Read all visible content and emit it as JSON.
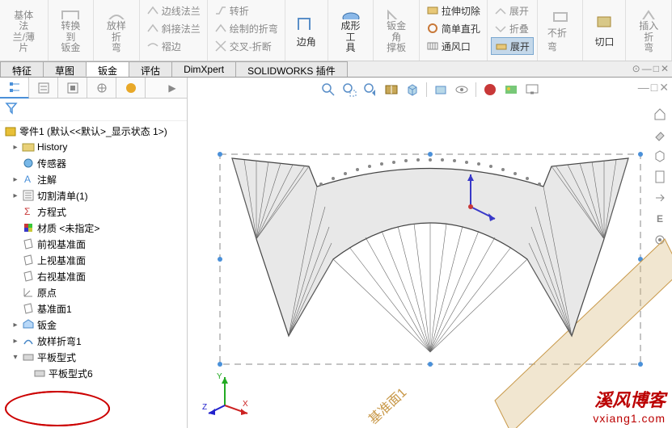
{
  "ribbon": {
    "base_flange": "基体法\n兰/薄片",
    "convert": "转换到\n钣金",
    "lofted_bend": "放样折\n弯",
    "edge_flange": "边线法兰",
    "miter_flange": "斜接法兰",
    "hem": "褶边",
    "jog": "转折",
    "sketched_bend": "绘制的折弯",
    "cross_break": "交叉-折断",
    "corner": "边角",
    "forming_tool": "成形工\n具",
    "gusset": "钣金角\n撑板",
    "extruded_cut": "拉伸切除",
    "simple_hole": "简单直孔",
    "vent": "通风口",
    "unfold": "展开",
    "fold": "折叠",
    "no_bends": "不折弯",
    "flatten": "展开",
    "cut": "切口",
    "insert_bends": "插入折\n弯"
  },
  "tabs": {
    "feature": "特征",
    "sketch": "草图",
    "sheetmetal": "钣金",
    "evaluate": "评估",
    "dimxpert": "DimXpert",
    "addins": "SOLIDWORKS 插件"
  },
  "tree": {
    "root": "零件1 (默认<<默认>_显示状态 1>)",
    "history": "History",
    "sensors": "传感器",
    "annotations": "注解",
    "cutlist": "切割清单(1)",
    "equations": "方程式",
    "material": "材质 <未指定>",
    "front_plane": "前视基准面",
    "top_plane": "上视基准面",
    "right_plane": "右视基准面",
    "origin": "原点",
    "plane1": "基准面1",
    "sheetmetal": "钣金",
    "lofted_bend1": "放样折弯1",
    "flat_pattern": "平板型式",
    "flat_pattern6": "平板型式6"
  },
  "viewport": {
    "plane_label": "基准面1"
  },
  "watermark": {
    "line1": "溪风博客",
    "line2": "vxiang1.com"
  },
  "triad": {
    "x": "X",
    "y": "Y",
    "z": "Z"
  }
}
